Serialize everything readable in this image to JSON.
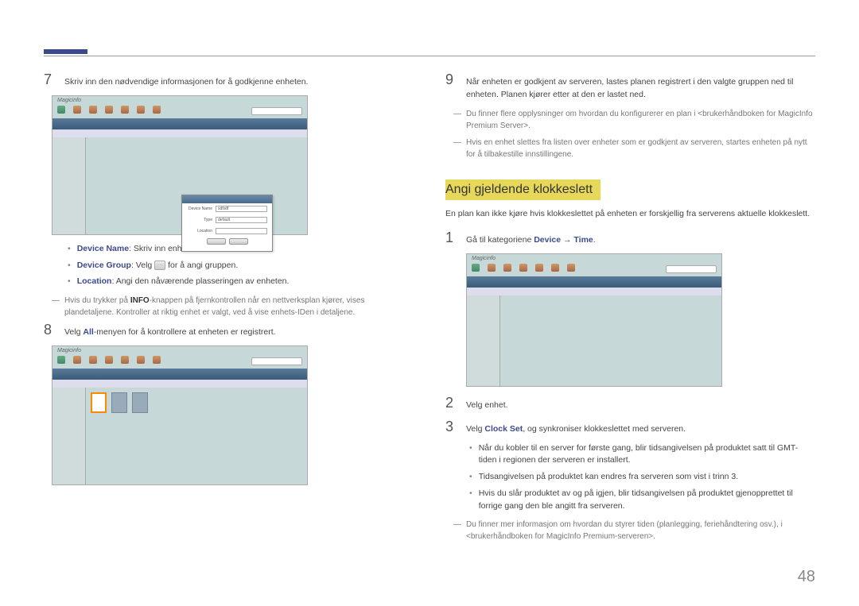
{
  "page_number": "48",
  "left": {
    "step7": {
      "text": "Skriv inn den nødvendige informasjonen for å godkjenne enheten.",
      "bullets": [
        {
          "label": "Device Name",
          "text": ": Skriv inn enhetsnavnet."
        },
        {
          "label": "Device Group",
          "text_pre": ": Velg ",
          "text_post": " for å angi gruppen."
        },
        {
          "label": "Location",
          "text": ": Angi den nåværende plasseringen av enheten."
        }
      ],
      "note_pre": "Hvis du trykker på ",
      "note_bold": "INFO",
      "note_post": "-knappen på fjernkontrollen når en nettverksplan kjører, vises plandetaljene. Kontroller at riktig enhet er valgt, ved å vise enhets-IDen i detaljene."
    },
    "step8": {
      "text_pre": "Velg ",
      "text_bold": "All",
      "text_post": "-menyen for å kontrollere at enheten er registrert."
    },
    "dialog": {
      "r1_label": "Device Name",
      "r1_value": "sdfsdf",
      "r2_label": "Type",
      "r2_value": "default",
      "r3_label": "Location",
      "r3_value": ""
    },
    "scr_title": "Magicinfo"
  },
  "right": {
    "step9": {
      "text": "Når enheten er godkjent av serveren, lastes planen registrert i den valgte gruppen ned til enheten. Planen kjører etter at den er lastet ned."
    },
    "notes": [
      "Du finner flere opplysninger om hvordan du konfigurerer en plan i <brukerhåndboken for MagicInfo Premium Server>.",
      "Hvis en enhet slettes fra listen over enheter som er godkjent av serveren, startes enheten på nytt for å tilbakestille innstillingene."
    ],
    "section_title": "Angi gjeldende klokkeslett",
    "section_intro": "En plan kan ikke kjøre hvis klokkeslettet på enheten er forskjellig fra serverens aktuelle klokkeslett.",
    "step1": {
      "pre": "Gå til kategoriene ",
      "bold1": "Device",
      "arrow": " → ",
      "bold2": "Time",
      "post": "."
    },
    "step2": "Velg enhet.",
    "step3": {
      "pre": "Velg ",
      "bold": "Clock Set",
      "post": ", og synkroniser klokkeslettet med serveren."
    },
    "bullets": [
      "Når du kobler til en server for første gang, blir tidsangivelsen på produktet satt til GMT-tiden i regionen der serveren er installert.",
      "Tidsangivelsen på produktet kan endres fra serveren som vist i trinn 3.",
      "Hvis du slår produktet av og på igjen, blir tidsangivelsen på produktet gjenopprettet til forrige gang den ble angitt fra serveren."
    ],
    "end_note": "Du finner mer informasjon om hvordan du styrer tiden (planlegging, feriehåndtering osv.), i <brukerhåndboken for MagicInfo Premium-serveren>."
  }
}
